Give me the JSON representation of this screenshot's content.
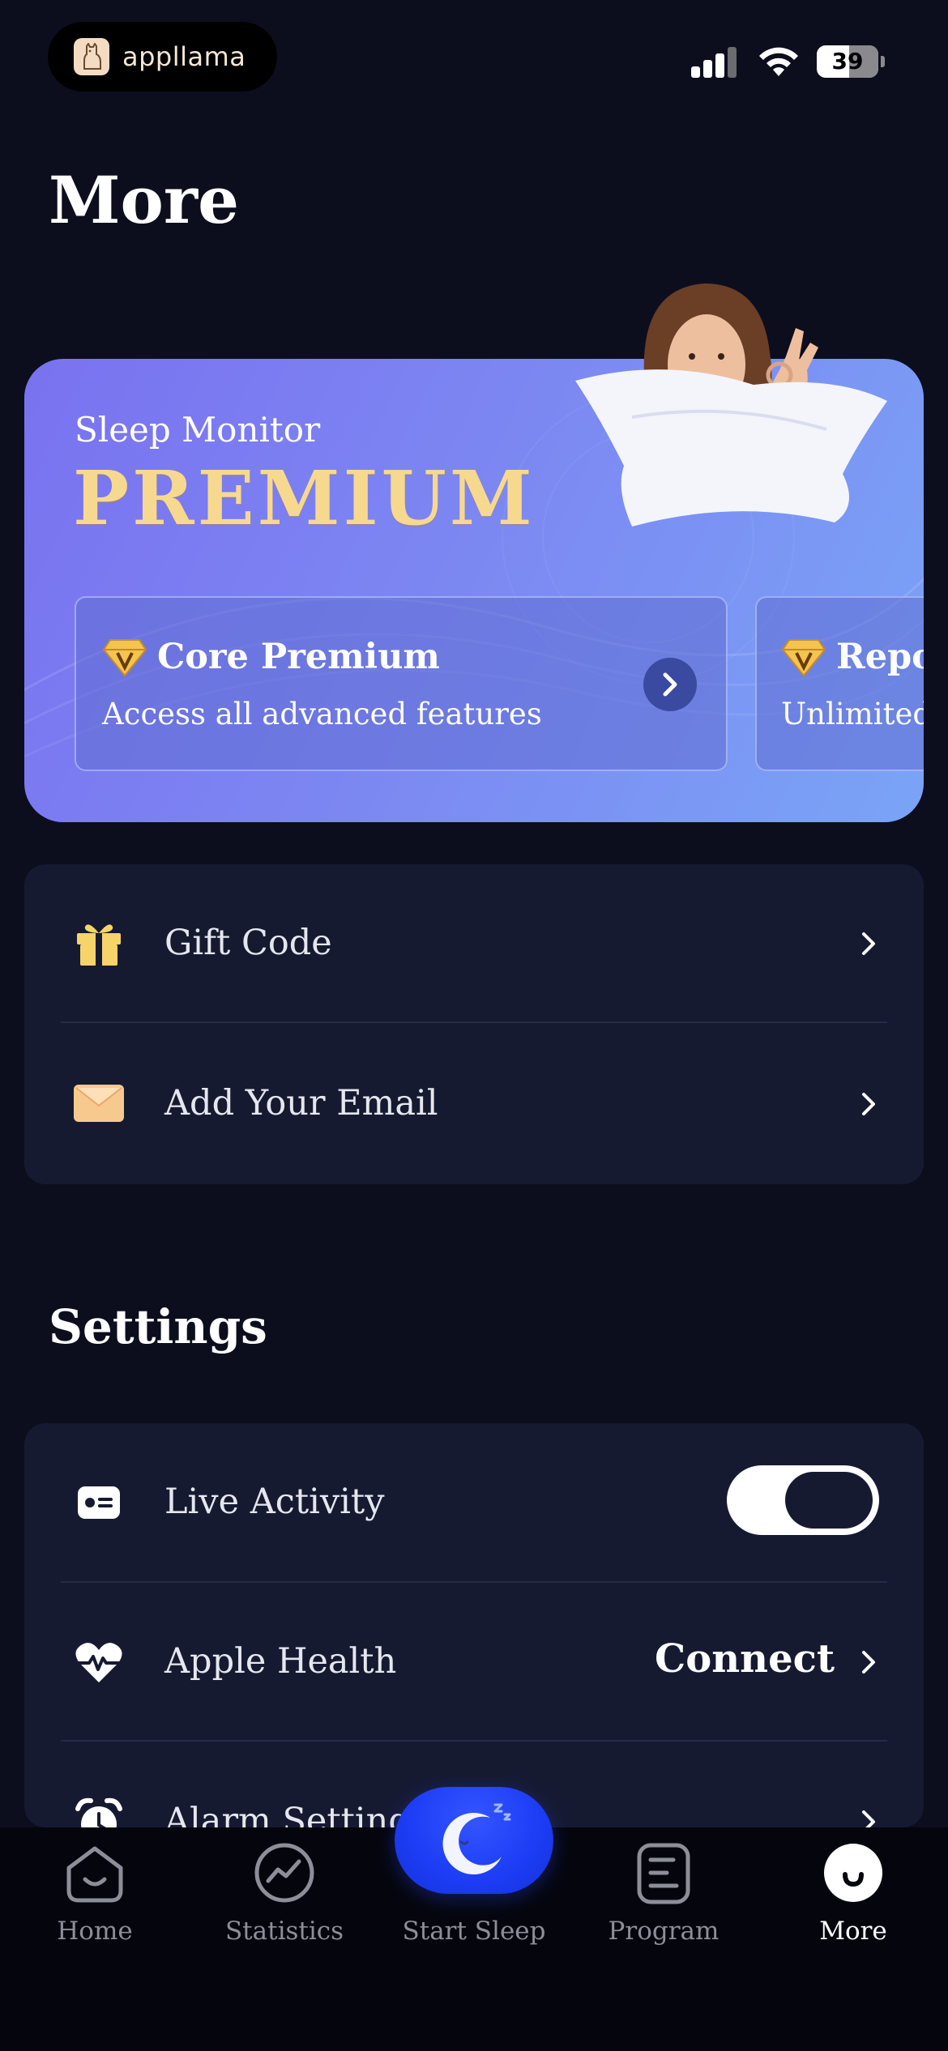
{
  "status_bar": {
    "brand": "appllama",
    "battery": "39"
  },
  "page": {
    "title": "More"
  },
  "premium": {
    "subtitle": "Sleep Monitor",
    "title": "PREMIUM",
    "cards": [
      {
        "title": "Core Premium",
        "description": "Access all advanced features",
        "icon": "gem-icon"
      },
      {
        "title": "Repo",
        "description": "Unlimited",
        "icon": "gem-icon"
      }
    ]
  },
  "account_items": [
    {
      "label": "Gift Code",
      "icon": "gift-icon"
    },
    {
      "label": "Add Your Email",
      "icon": "envelope-icon"
    }
  ],
  "settings": {
    "title": "Settings",
    "items": [
      {
        "label": "Live Activity",
        "icon": "live-activity-icon",
        "toggle_on": true
      },
      {
        "label": "Apple Health",
        "icon": "heartbeat-icon",
        "value": "Connect"
      },
      {
        "label": "Alarm Settings",
        "icon": "alarm-icon"
      }
    ]
  },
  "tab_bar": {
    "tabs": [
      {
        "label": "Home",
        "icon": "home-icon"
      },
      {
        "label": "Statistics",
        "icon": "statistics-icon"
      },
      {
        "label": "Start Sleep",
        "icon": "moon-icon"
      },
      {
        "label": "Program",
        "icon": "program-icon"
      },
      {
        "label": "More",
        "icon": "more-icon",
        "active": true
      }
    ]
  },
  "colors": {
    "background": "#0c0e1e",
    "card": "#161a31",
    "premium_gold": "#f6d98f",
    "accent_blue": "#1c3cf5"
  }
}
